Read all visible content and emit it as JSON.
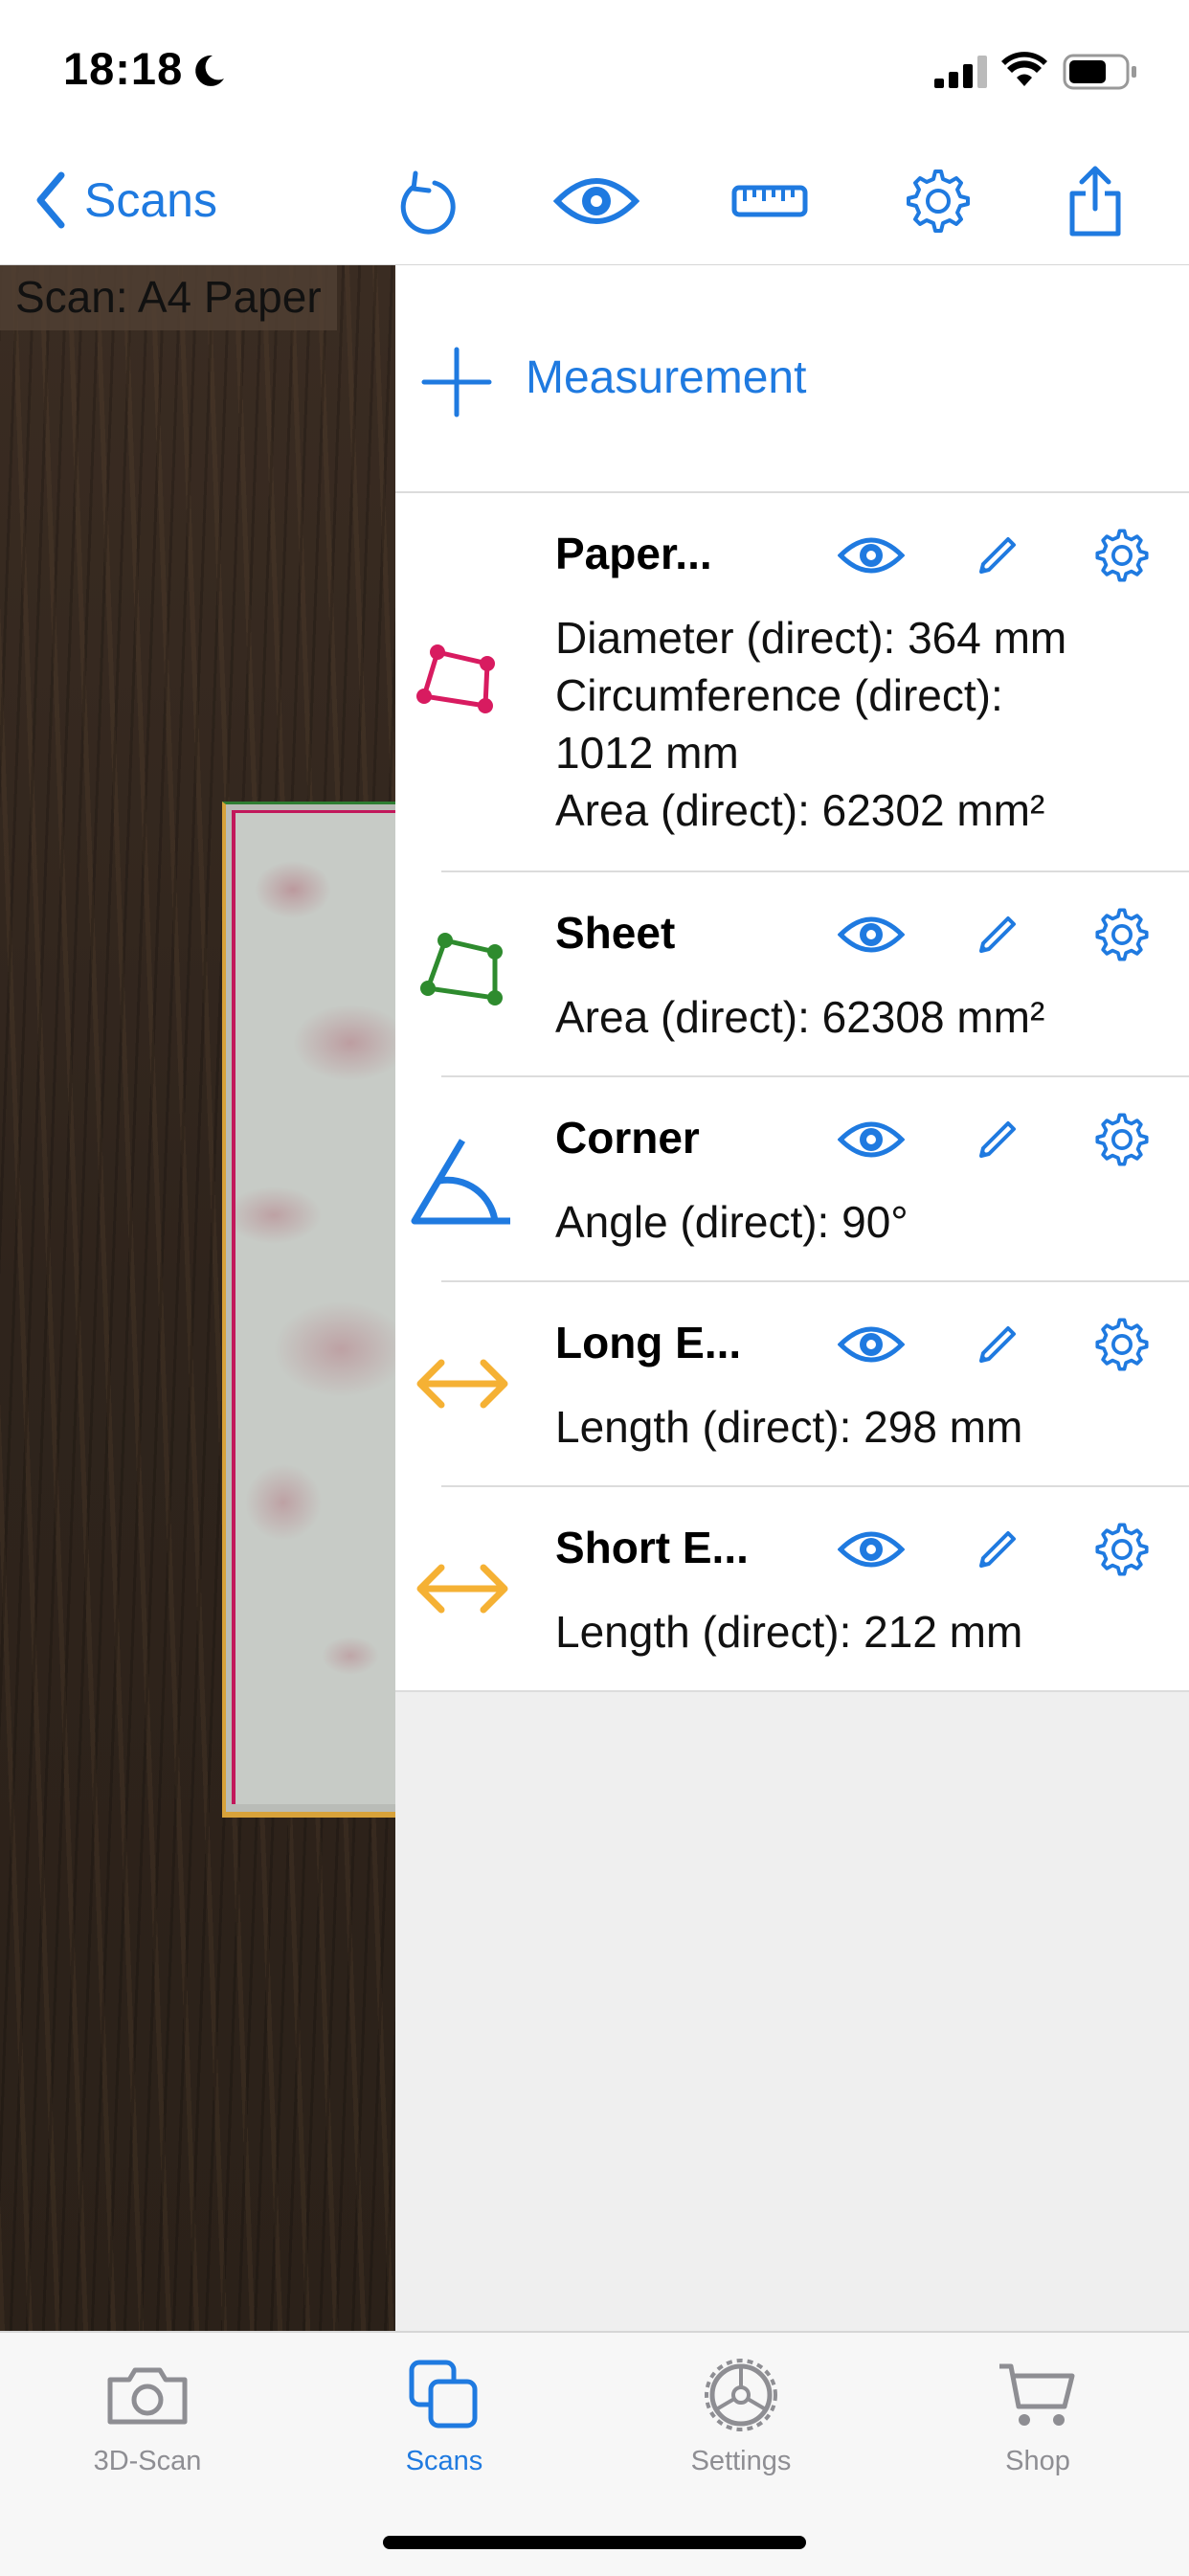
{
  "status_bar": {
    "time": "18:18"
  },
  "nav": {
    "back_label": "Scans",
    "icons": [
      "undo-icon",
      "eye-icon",
      "ruler-icon",
      "gear-icon",
      "share-icon"
    ]
  },
  "scan": {
    "label": "Scan: A4 Paper"
  },
  "panel": {
    "add_label": "Measurement",
    "measurements": [
      {
        "title": "Paper...",
        "shape": "polygon",
        "color": "#d81b60",
        "lines": [
          "Diameter (direct): 364 mm",
          "Circumference (direct):",
          "1012 mm",
          "Area (direct): 62302 mm²"
        ]
      },
      {
        "title": "Sheet",
        "shape": "polygon",
        "color": "#2e8b2e",
        "lines": [
          "Area (direct): 62308 mm²"
        ]
      },
      {
        "title": "Corner",
        "shape": "angle",
        "color": "#1f7ae0",
        "lines": [
          "Angle (direct): 90°"
        ]
      },
      {
        "title": "Long E...",
        "shape": "double-arrow",
        "color": "#f5b134",
        "lines": [
          "Length (direct): 298 mm"
        ]
      },
      {
        "title": "Short E...",
        "shape": "double-arrow",
        "color": "#f5b134",
        "lines": [
          "Length (direct): 212 mm"
        ]
      }
    ]
  },
  "tabbar": {
    "tabs": [
      {
        "label": "3D-Scan",
        "icon": "camera-icon",
        "active": false
      },
      {
        "label": "Scans",
        "icon": "scans-icon",
        "active": true
      },
      {
        "label": "Settings",
        "icon": "settings-icon",
        "active": false
      },
      {
        "label": "Shop",
        "icon": "cart-icon",
        "active": false
      }
    ]
  },
  "colors": {
    "accent": "#1f7ae0",
    "inactive_tab": "#8e8e93"
  }
}
